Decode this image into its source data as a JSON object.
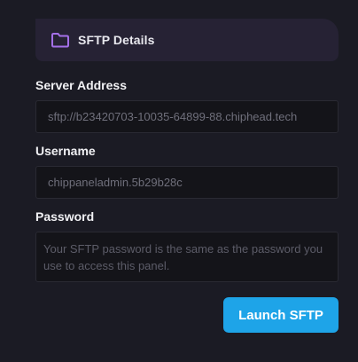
{
  "header": {
    "title": "SFTP Details",
    "icon": "folder-icon",
    "icon_color": "#a470e8"
  },
  "fields": {
    "server_address": {
      "label": "Server Address",
      "value": "sftp://b23420703-10035-64899-88.chiphead.tech"
    },
    "username": {
      "label": "Username",
      "value": "chippaneladmin.5b29b28c"
    },
    "password": {
      "label": "Password",
      "value": "Your SFTP password is the same as the password you use to access this panel."
    }
  },
  "launch_button": {
    "label": "Launch SFTP"
  },
  "colors": {
    "background": "#1b1b24",
    "header_background": "#262234",
    "button": "#1ea4e8",
    "field_background": "#141419"
  }
}
